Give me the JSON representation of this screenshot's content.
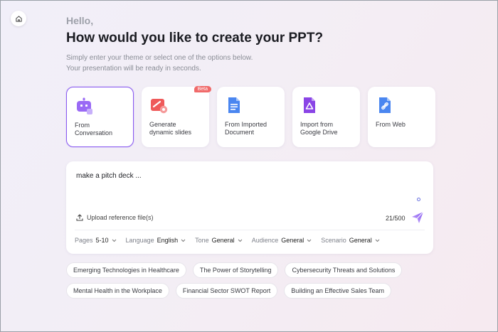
{
  "header": {
    "greeting": "Hello,",
    "title": "How would you like to create your PPT?",
    "subtitle_line1": "Simply enter your theme or select one of the options below.",
    "subtitle_line2": "Your presentation will be ready in seconds."
  },
  "options": [
    {
      "line1": "From",
      "line2": "Conversation",
      "icon": "robot-icon",
      "selected": true
    },
    {
      "line1": "Generate",
      "line2": "dynamic slides",
      "icon": "slides-icon",
      "badge": "Beta"
    },
    {
      "line1": "From Imported",
      "line2": "Document",
      "icon": "document-icon"
    },
    {
      "line1": "Import from",
      "line2": "Google Drive",
      "icon": "google-drive-icon"
    },
    {
      "line1": "From Web",
      "line2": "",
      "icon": "web-link-icon"
    }
  ],
  "prompt": {
    "value": "make a pitch deck ...",
    "upload_label": "Upload reference file(s)",
    "counter": "21/500"
  },
  "settings": [
    {
      "key": "Pages",
      "value": "5-10"
    },
    {
      "key": "Language",
      "value": "English"
    },
    {
      "key": "Tone",
      "value": "General"
    },
    {
      "key": "Audience",
      "value": "General"
    },
    {
      "key": "Scenario",
      "value": "General"
    }
  ],
  "suggestions": [
    "Emerging Technologies in Healthcare",
    "The Power of Storytelling",
    "Cybersecurity Threats and Solutions",
    "Mental Health in the Workplace",
    "Financial Sector SWOT Report",
    "Building an Effective Sales Team"
  ],
  "colors": {
    "accent": "#8a5cf0",
    "badge": "#f06a6a"
  }
}
